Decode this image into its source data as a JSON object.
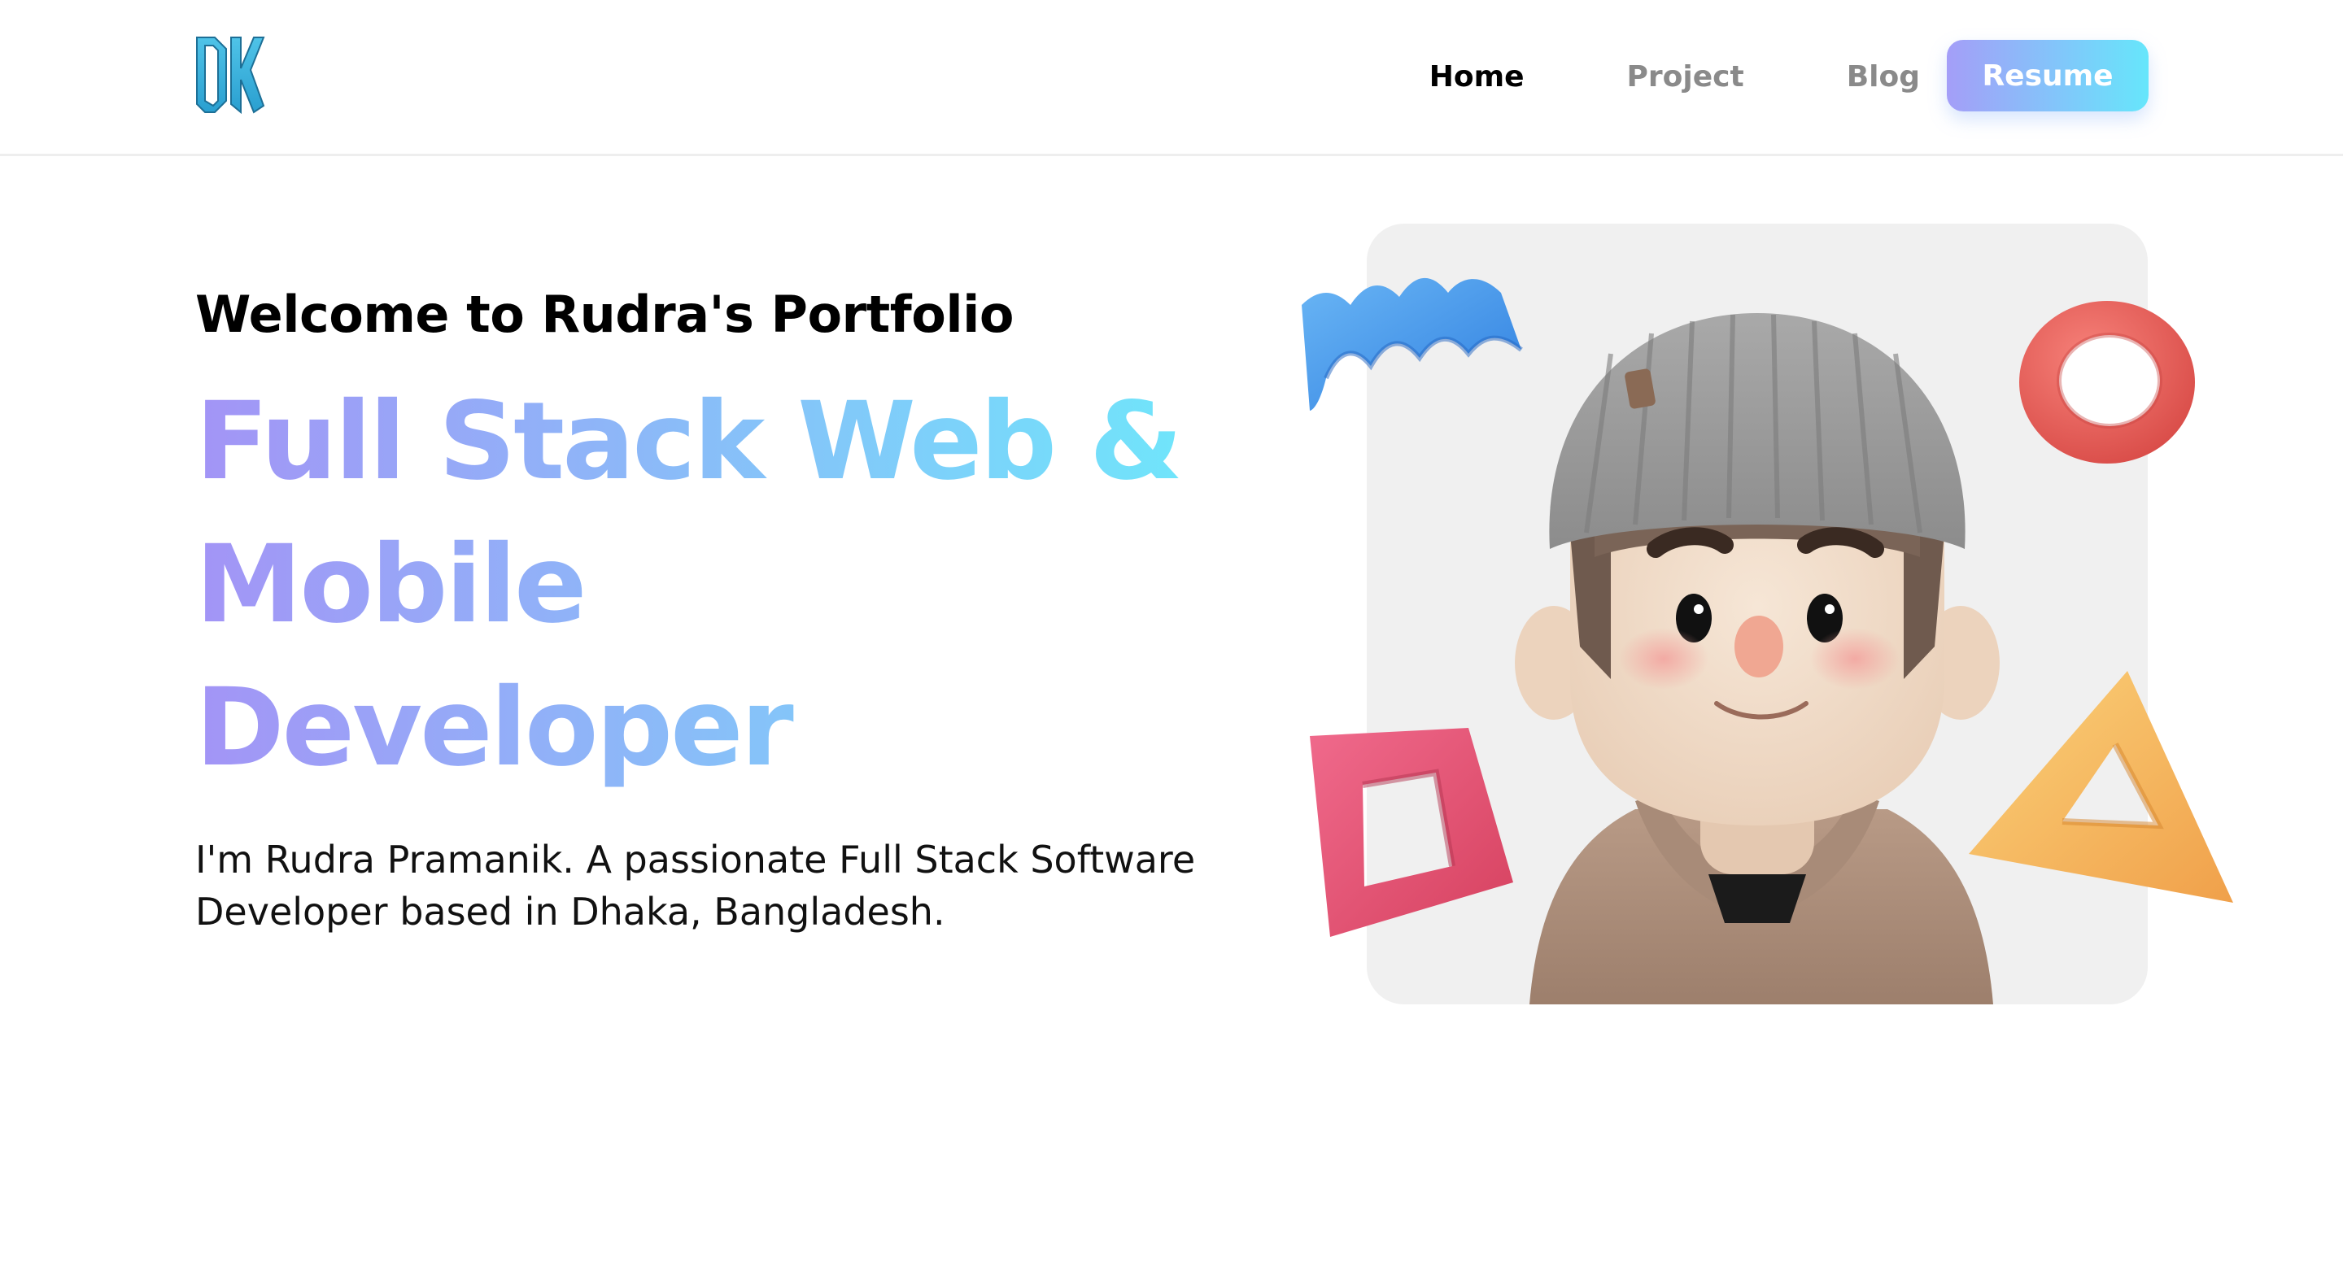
{
  "header": {
    "logo_name": "dk-logo",
    "nav": {
      "home": "Home",
      "project": "Project",
      "blog": "Blog"
    },
    "resume_label": "Resume"
  },
  "hero": {
    "welcome": "Welcome to Rudra's Portfolio",
    "headline_line1": "Full Stack Web &",
    "headline_line2": "Mobile",
    "headline_line3": "Developer",
    "intro": "I'm Rudra Pramanik. A passionate Full Stack Software Developer based in Dhaka, Bangladesh."
  },
  "colors": {
    "accent_start": "#a49ef8",
    "accent_end": "#66e6fb",
    "card_bg": "#f0f0f0"
  },
  "illustration": {
    "avatar": "3d-avatar-beanie-hoodie",
    "shapes": [
      "blue-wave-shape",
      "red-torus-shape",
      "pink-square-frame-shape",
      "orange-triangle-shape"
    ]
  }
}
